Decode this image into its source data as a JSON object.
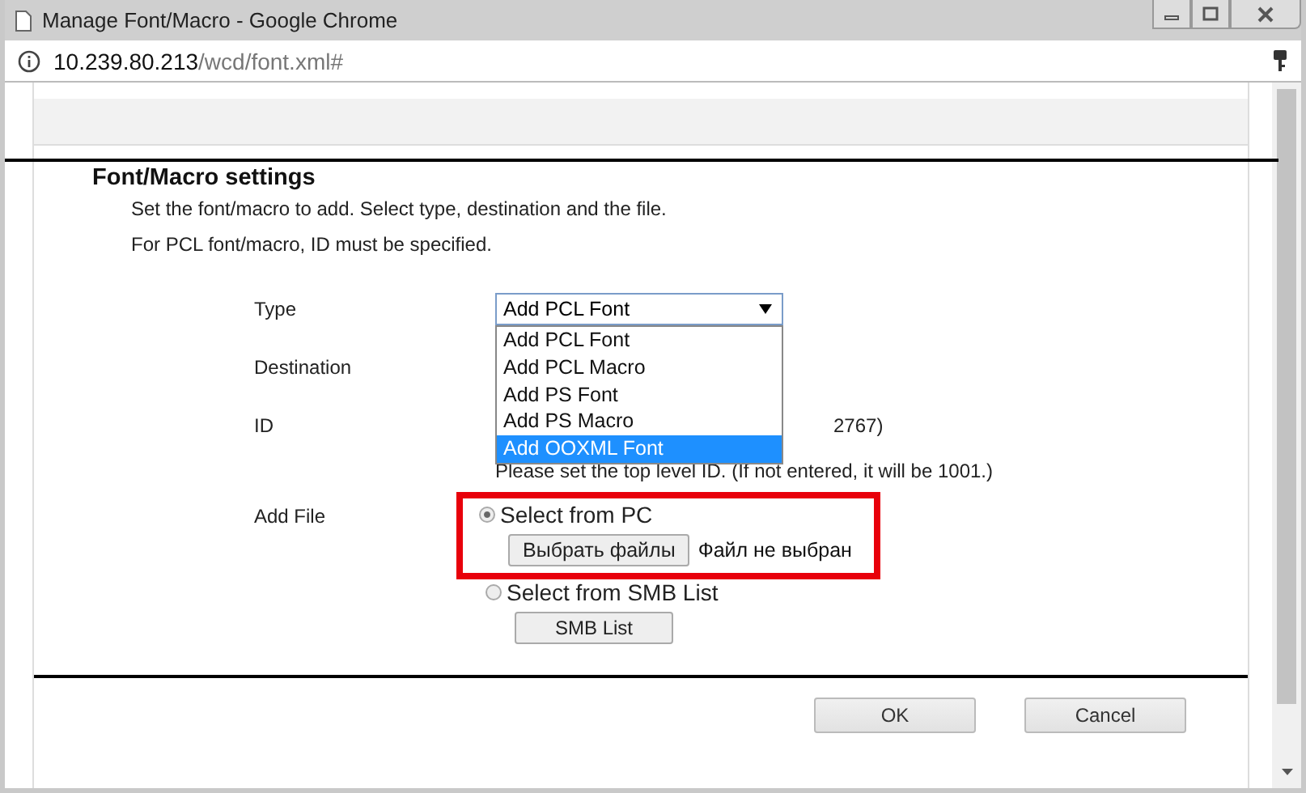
{
  "window": {
    "title": "Manage Font/Macro - Google Chrome"
  },
  "address_bar": {
    "host": "10.239.80.213",
    "path": "/wcd/font.xml#"
  },
  "section": {
    "title": "Font/Macro settings",
    "descriptions": [
      "Set the font/macro to add. Select type, destination and the file.",
      "For PCL font/macro, ID must be specified."
    ]
  },
  "form": {
    "type": {
      "label": "Type",
      "value": "Add PCL Font",
      "expanded": true,
      "options": [
        {
          "label": "Add PCL Font",
          "highlighted": false
        },
        {
          "label": "Add PCL Macro",
          "highlighted": false
        },
        {
          "label": "Add PS Font",
          "highlighted": false
        },
        {
          "label": "Add PS Macro",
          "highlighted": false
        },
        {
          "label": "Add OOXML Font",
          "highlighted": true
        }
      ]
    },
    "destination": {
      "label": "Destination"
    },
    "id": {
      "label": "ID",
      "range_fragment": "2767)",
      "hint": "Please set the top level ID. (If not entered, it will be 1001.)"
    },
    "add_file": {
      "label": "Add File",
      "options": [
        {
          "kind": "file",
          "label": "Select from PC",
          "selected": true,
          "outlined": true,
          "button": "Выбрать файлы",
          "status": "Файл не выбран"
        },
        {
          "kind": "smb",
          "label": "Select from SMB List",
          "selected": false,
          "outlined": false,
          "button": "SMB List"
        }
      ]
    }
  },
  "buttons": [
    {
      "label": "OK"
    },
    {
      "label": "Cancel"
    }
  ]
}
